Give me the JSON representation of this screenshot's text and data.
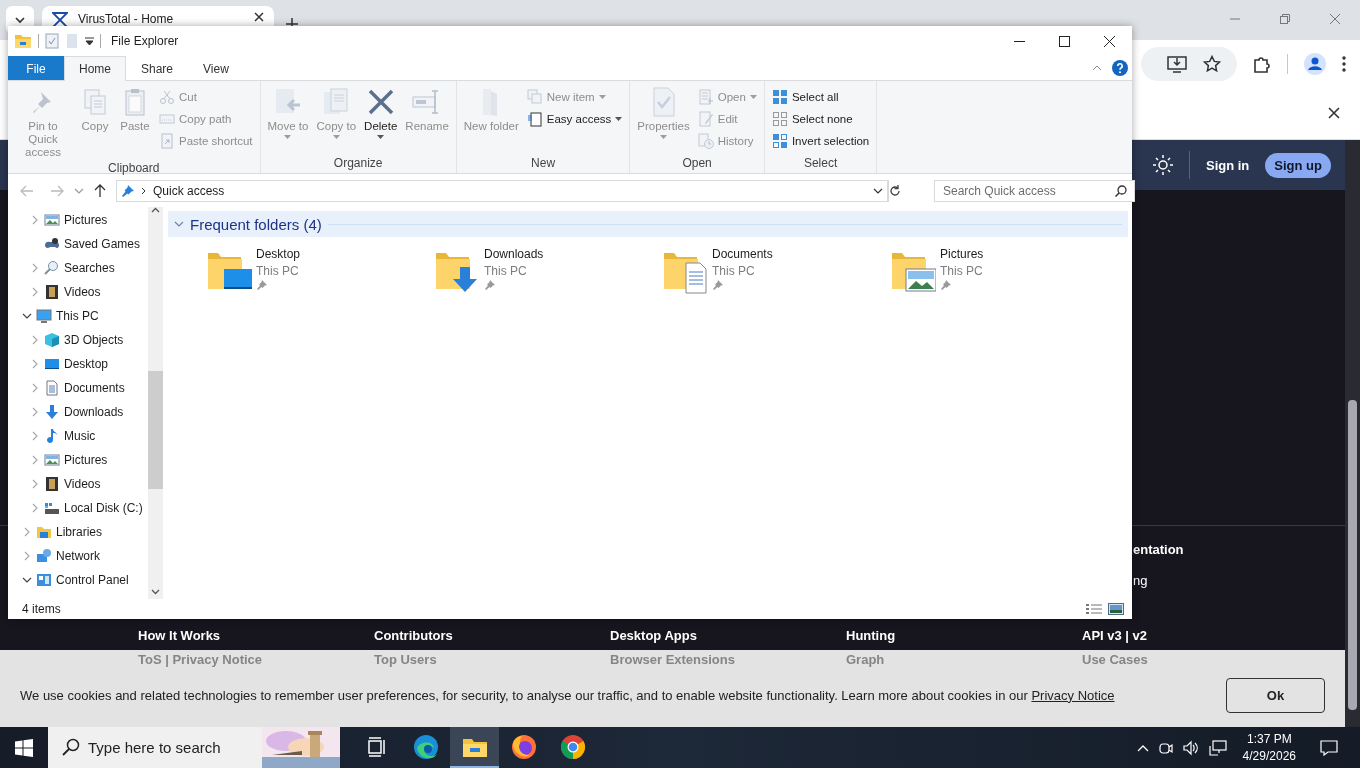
{
  "browser": {
    "tabs": [
      {
        "title": "VirusTotal - Home",
        "selected": true
      }
    ],
    "site": {
      "sign_in": "Sign in",
      "sign_up": "Sign up",
      "background_texts": [
        {
          "text": "entation",
          "kind": "heading"
        },
        {
          "text": "ng",
          "kind": "link"
        }
      ],
      "footer_rows": [
        {
          "kind": "heading",
          "links": [
            "How It Works",
            "Contributors",
            "Desktop Apps",
            "Hunting",
            "API v3 | v2"
          ]
        },
        {
          "kind": "faded",
          "links": [
            "ToS | Privacy Notice",
            "Top Users",
            "Browser Extensions",
            "Graph",
            "Use Cases"
          ]
        }
      ],
      "cookie_banner": {
        "text": "We use cookies and related technologies to remember user preferences, for security, to analyse our traffic, and to enable website functionality. Learn more about cookies in our",
        "link": "Privacy Notice",
        "button": "Ok"
      }
    }
  },
  "explorer": {
    "title": "File Explorer",
    "ribbon_tabs": [
      {
        "label": "File",
        "kind": "file",
        "selected": false
      },
      {
        "label": "Home",
        "kind": "tab",
        "selected": true
      },
      {
        "label": "Share",
        "kind": "tab",
        "selected": false
      },
      {
        "label": "View",
        "kind": "tab",
        "selected": false
      }
    ],
    "ribbon": {
      "groups": [
        {
          "label": "Clipboard",
          "items": [
            {
              "label": "Pin to Quick access",
              "kind": "large",
              "disabled": true
            },
            {
              "label": "Copy",
              "kind": "large",
              "disabled": true
            },
            {
              "label": "Paste",
              "kind": "large",
              "disabled": true
            },
            {
              "label": "Cut",
              "kind": "small",
              "disabled": true
            },
            {
              "label": "Copy path",
              "kind": "small",
              "disabled": true
            },
            {
              "label": "Paste shortcut",
              "kind": "small",
              "disabled": true
            }
          ]
        },
        {
          "label": "Organize",
          "items": [
            {
              "label": "Move to",
              "kind": "large",
              "disabled": true,
              "dropdown": true
            },
            {
              "label": "Copy to",
              "kind": "large",
              "disabled": true,
              "dropdown": true
            },
            {
              "label": "Delete",
              "kind": "large",
              "disabled": false,
              "dropdown": true
            },
            {
              "label": "Rename",
              "kind": "large",
              "disabled": true
            }
          ]
        },
        {
          "label": "New",
          "items": [
            {
              "label": "New folder",
              "kind": "large",
              "disabled": true
            },
            {
              "label": "New item",
              "kind": "small",
              "disabled": true,
              "dropdown": true
            },
            {
              "label": "Easy access",
              "kind": "small",
              "disabled": false,
              "dropdown": true
            }
          ]
        },
        {
          "label": "Open",
          "items": [
            {
              "label": "Properties",
              "kind": "large",
              "disabled": true,
              "dropdown": true
            },
            {
              "label": "Open",
              "kind": "small",
              "disabled": true,
              "dropdown": true
            },
            {
              "label": "Edit",
              "kind": "small",
              "disabled": true
            },
            {
              "label": "History",
              "kind": "small",
              "disabled": true
            }
          ]
        },
        {
          "label": "Select",
          "items": [
            {
              "label": "Select all",
              "kind": "small",
              "disabled": false
            },
            {
              "label": "Select none",
              "kind": "small",
              "disabled": false
            },
            {
              "label": "Invert selection",
              "kind": "small",
              "disabled": false
            }
          ]
        }
      ]
    },
    "address": "Quick access",
    "search": {
      "placeholder": "Search Quick access"
    },
    "nav_tree": [
      {
        "children": [
          {
            "label": "Pictures",
            "expandable": true,
            "expanded": false
          },
          {
            "label": "Saved Games",
            "expandable": false
          },
          {
            "label": "Searches",
            "expandable": true,
            "expanded": false
          },
          {
            "label": "Videos",
            "expandable": true,
            "expanded": false
          }
        ]
      },
      {
        "label": "This PC",
        "expandable": true,
        "expanded": true,
        "children": [
          {
            "label": "3D Objects",
            "expandable": true,
            "expanded": false
          },
          {
            "label": "Desktop",
            "expandable": true,
            "expanded": false
          },
          {
            "label": "Documents",
            "expandable": true,
            "expanded": false
          },
          {
            "label": "Downloads",
            "expandable": true,
            "expanded": false
          },
          {
            "label": "Music",
            "expandable": true,
            "expanded": false
          },
          {
            "label": "Pictures",
            "expandable": true,
            "expanded": false
          },
          {
            "label": "Videos",
            "expandable": true,
            "expanded": false
          },
          {
            "label": "Local Disk (C:)",
            "expandable": true,
            "expanded": false
          }
        ]
      },
      {
        "label": "Libraries",
        "expandable": true,
        "expanded": false
      },
      {
        "label": "Network",
        "expandable": true,
        "expanded": false
      },
      {
        "label": "Control Panel",
        "expandable": true,
        "expanded": true
      }
    ],
    "section": {
      "title": "Frequent folders (4)",
      "expanded": true,
      "folders": [
        {
          "name": "Desktop",
          "location": "This PC",
          "pinned": true
        },
        {
          "name": "Downloads",
          "location": "This PC",
          "pinned": true
        },
        {
          "name": "Documents",
          "location": "This PC",
          "pinned": true
        },
        {
          "name": "Pictures",
          "location": "This PC",
          "pinned": true
        }
      ]
    },
    "status": "4 items"
  },
  "taskbar": {
    "search": {
      "placeholder": "Type here to search"
    },
    "apps": [
      {
        "kind": "taskview",
        "selected": false
      },
      {
        "kind": "edge",
        "selected": false
      },
      {
        "kind": "explorer",
        "selected": true
      },
      {
        "kind": "firefox",
        "selected": false
      },
      {
        "kind": "chrome",
        "selected": false
      }
    ],
    "time": "1:37 PM",
    "date": "4/29/2026"
  }
}
